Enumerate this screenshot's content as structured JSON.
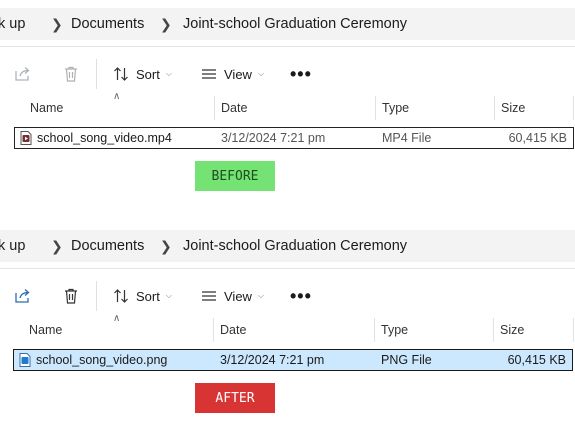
{
  "colors": {
    "before_badge_bg": "#74e374",
    "before_badge_text": "#1e4d1e",
    "after_badge_bg": "#d93434",
    "after_badge_text": "#ffffff",
    "selected_row_bg": "#cce8ff"
  },
  "before": {
    "breadcrumb": [
      "k up",
      "Documents",
      "Joint-school Graduation Ceremony"
    ],
    "toolbar": {
      "share_icon": "share-icon",
      "delete_icon": "delete-icon",
      "sort_label": "Sort",
      "view_label": "View",
      "more_label": "•••"
    },
    "columns": [
      "Name",
      "Date",
      "Type",
      "Size"
    ],
    "file": {
      "name": "school_song_video.mp4",
      "date": "3/12/2024 7:21 pm",
      "type": "MP4 File",
      "size": "60,415 KB",
      "icon": "video-file-icon",
      "selected": false
    },
    "badge": "BEFORE"
  },
  "after": {
    "breadcrumb": [
      "k up",
      "Documents",
      "Joint-school Graduation Ceremony"
    ],
    "toolbar": {
      "share_icon": "share-icon",
      "delete_icon": "delete-icon",
      "sort_label": "Sort",
      "view_label": "View",
      "more_label": "•••"
    },
    "columns": [
      "Name",
      "Date",
      "Type",
      "Size"
    ],
    "file": {
      "name": "school_song_video.png",
      "date": "3/12/2024 7:21 pm",
      "type": "PNG File",
      "size": "60,415 KB",
      "icon": "image-file-icon",
      "selected": true
    },
    "badge": "AFTER"
  }
}
